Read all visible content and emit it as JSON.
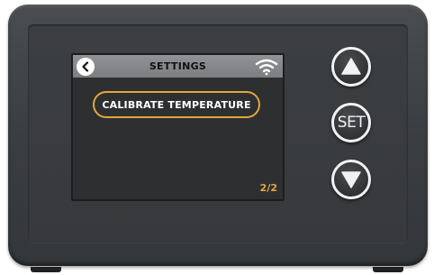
{
  "screen": {
    "title": "SETTINGS",
    "menu_option": "CALIBRATE TEMPERATURE",
    "page_indicator": "2/2",
    "icons": {
      "back": "chevron-left-icon",
      "status": "wifi-icon"
    }
  },
  "hardware_buttons": {
    "up_icon": "up-arrow-icon",
    "set_label": "SET",
    "down_icon": "down-arrow-icon"
  },
  "colors": {
    "accent": "#e0a83a",
    "screen_bg": "#2e2f31",
    "header_bg": "#86888b",
    "housing": "#3c3f42"
  }
}
